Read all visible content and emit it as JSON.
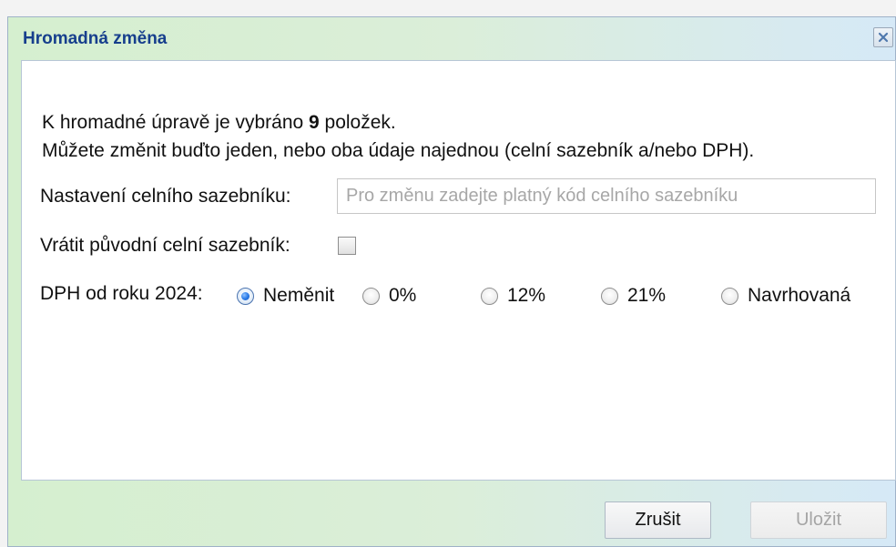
{
  "dialog": {
    "title": "Hromadná změna",
    "close_label": "×"
  },
  "intro": {
    "line1_prefix": "K hromadné úpravě je vybráno ",
    "count": "9",
    "line1_suffix": " položek.",
    "line2": "Můžete změnit buďto jeden, nebo oba údaje najednou (celní sazebník a/nebo DPH)."
  },
  "tariff": {
    "label": "Nastavení celního sazebníku:",
    "value": "",
    "placeholder": "Pro změnu zadejte platný kód celního sazebníku"
  },
  "restore": {
    "label": "Vrátit původní celní sazebník:",
    "checked": false
  },
  "vat": {
    "label": "DPH od roku 2024:",
    "options": [
      {
        "label": "Neměnit",
        "selected": true
      },
      {
        "label": "0%",
        "selected": false
      },
      {
        "label": "12%",
        "selected": false
      },
      {
        "label": "21%",
        "selected": false
      },
      {
        "label": "Navrhovaná",
        "selected": false
      }
    ]
  },
  "footer": {
    "cancel_label": "Zrušit",
    "save_label": "Uložit",
    "save_disabled": true
  },
  "colors": {
    "title": "#173f8d",
    "radio_selected": "#2d7de8",
    "placeholder": "#a7a7a7"
  }
}
